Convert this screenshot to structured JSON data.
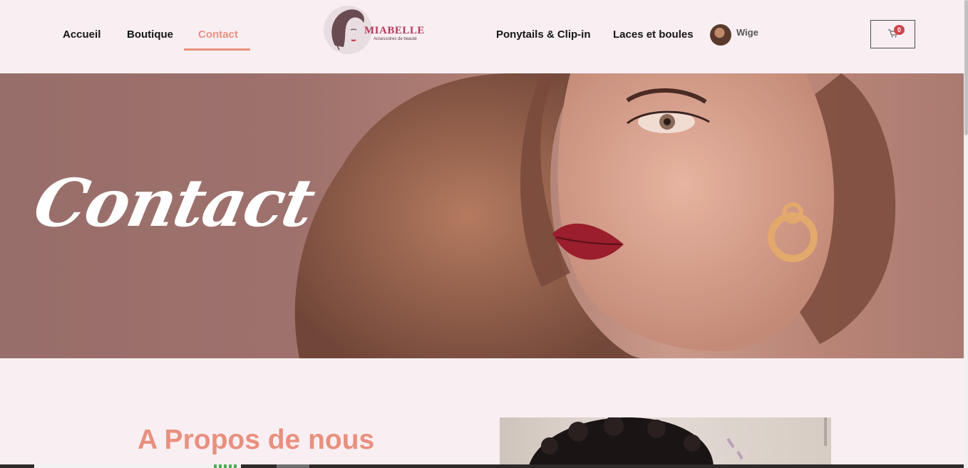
{
  "nav_left": [
    {
      "label": "Accueil"
    },
    {
      "label": "Boutique"
    },
    {
      "label": "Contact",
      "active": true
    }
  ],
  "brand": {
    "name": "MIABELLE",
    "tagline": "Accessoires de beauté"
  },
  "nav_right": [
    {
      "label": "Ponytails & Clip-in"
    },
    {
      "label": "Laces et boules"
    }
  ],
  "user": {
    "name": "Wige"
  },
  "cart": {
    "count": "0",
    "icon": "cart-icon"
  },
  "hero": {
    "title": "Contact"
  },
  "about": {
    "heading": "A Propos de nous"
  },
  "colors": {
    "accent": "#e8907f",
    "background": "#f9eff3",
    "badge": "#d0454b",
    "brand": "#b23a5c"
  }
}
